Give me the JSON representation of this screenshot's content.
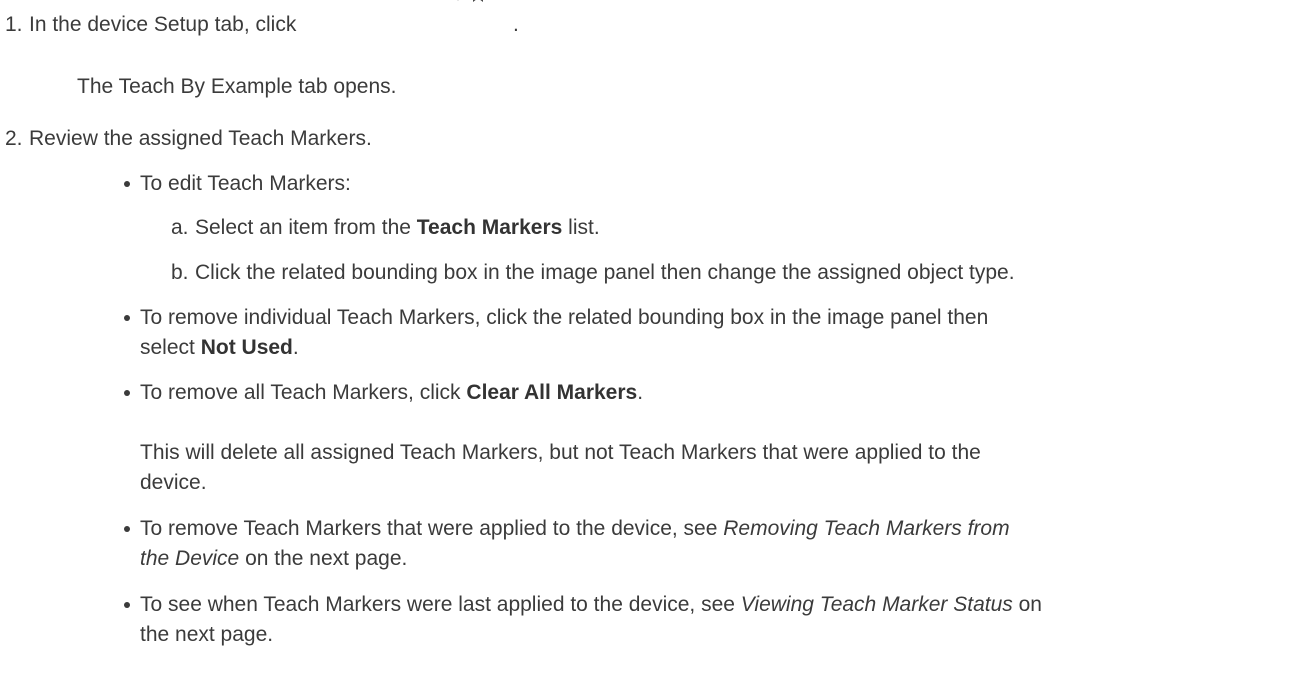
{
  "steps": [
    {
      "number": "1.",
      "text_before_icon": "In the device Setup tab, click",
      "text_after_icon": ".",
      "result": "The Teach By Example tab opens."
    },
    {
      "number": "2.",
      "text": "Review the assigned Teach Markers.",
      "bullets": [
        {
          "text": "To edit Teach Markers:",
          "substeps": [
            {
              "letter": "a.",
              "before": "Select an item from the",
              "bold": "Teach Markers",
              "after": "list."
            },
            {
              "letter": "b.",
              "text": "Click the related bounding box in the image panel then change the assigned object type."
            }
          ]
        },
        {
          "line1": "To remove individual Teach Markers, click the related bounding box in the image panel then",
          "line2_before": "select",
          "line2_bold": "Not Used",
          "line2_after": "."
        },
        {
          "before": "To remove all Teach Markers, click",
          "bold": "Clear All Markers",
          "after": ".",
          "note_line1": "This will delete all assigned Teach Markers, but not Teach Markers that were applied to the",
          "note_line2": "device."
        },
        {
          "before": "To remove Teach Markers that were applied to the device, see",
          "italic1": "Removing Teach Markers from",
          "italic2": "the Device",
          "after": "on the next page."
        },
        {
          "before": "To see when Teach Markers were last applied to the device, see",
          "italic": "Viewing Teach Marker Status",
          "after": "on",
          "line2": "the next page."
        }
      ]
    }
  ],
  "icons": {
    "teach_by_example": "teach-by-example-icon"
  }
}
